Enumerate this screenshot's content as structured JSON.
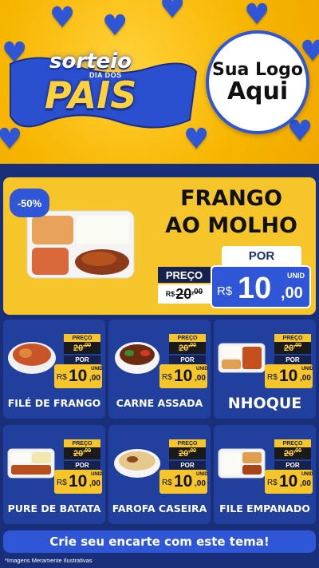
{
  "header": {
    "title_line1": "sorteio",
    "title_small": "DIA DOS",
    "title_line2": "PAIS",
    "logo_line1": "Sua Logo",
    "logo_line2": "Aqui"
  },
  "featured": {
    "discount": "-50%",
    "name_line1": "FRANGO",
    "name_line2": "AO MOLHO",
    "preco_label": "PREÇO",
    "old_currency": "R$",
    "old_value": "20",
    "old_cents": ",00",
    "por_label": "POR",
    "new_currency": "R$",
    "new_value": "10",
    "new_cents": ",00",
    "unit": "UNID"
  },
  "products": [
    {
      "name": "FILÉ DE FRANGO",
      "preco_label": "PREÇO",
      "old_value": "20",
      "old_cents": ",00",
      "por_label": "POR",
      "currency": "R$",
      "value": "10",
      "cents": ",00",
      "unit": "UNID"
    },
    {
      "name": "CARNE ASSADA",
      "preco_label": "PREÇO",
      "old_value": "20",
      "old_cents": ",00",
      "por_label": "POR",
      "currency": "R$",
      "value": "10",
      "cents": ",00",
      "unit": "UNID"
    },
    {
      "name": "NHOQUE",
      "preco_label": "PREÇO",
      "old_value": "20",
      "old_cents": ",00",
      "por_label": "POR",
      "currency": "R$",
      "value": "10",
      "cents": ",00",
      "unit": "UNID"
    },
    {
      "name": "PURE DE BATATA",
      "preco_label": "PREÇO",
      "old_value": "20",
      "old_cents": ",00",
      "por_label": "POR",
      "currency": "R$",
      "value": "10",
      "cents": ",00",
      "unit": "UNID"
    },
    {
      "name": "FAROFA CASEIRA",
      "preco_label": "PREÇO",
      "old_value": "20",
      "old_cents": ",00",
      "por_label": "POR",
      "currency": "R$",
      "value": "10",
      "cents": ",00",
      "unit": "UNID"
    },
    {
      "name": "FILE EMPANADO",
      "preco_label": "PREÇO",
      "old_value": "20",
      "old_cents": ",00",
      "por_label": "POR",
      "currency": "R$",
      "value": "10",
      "cents": ",00",
      "unit": "UNID"
    }
  ],
  "cta_label": "Crie seu encarte com este tema!",
  "disclaimer": "*Imagens Meramente Ilustrativas",
  "colors": {
    "yellow": "#f5c52a",
    "blue": "#2f56d6",
    "navy": "#1a2f7a"
  }
}
